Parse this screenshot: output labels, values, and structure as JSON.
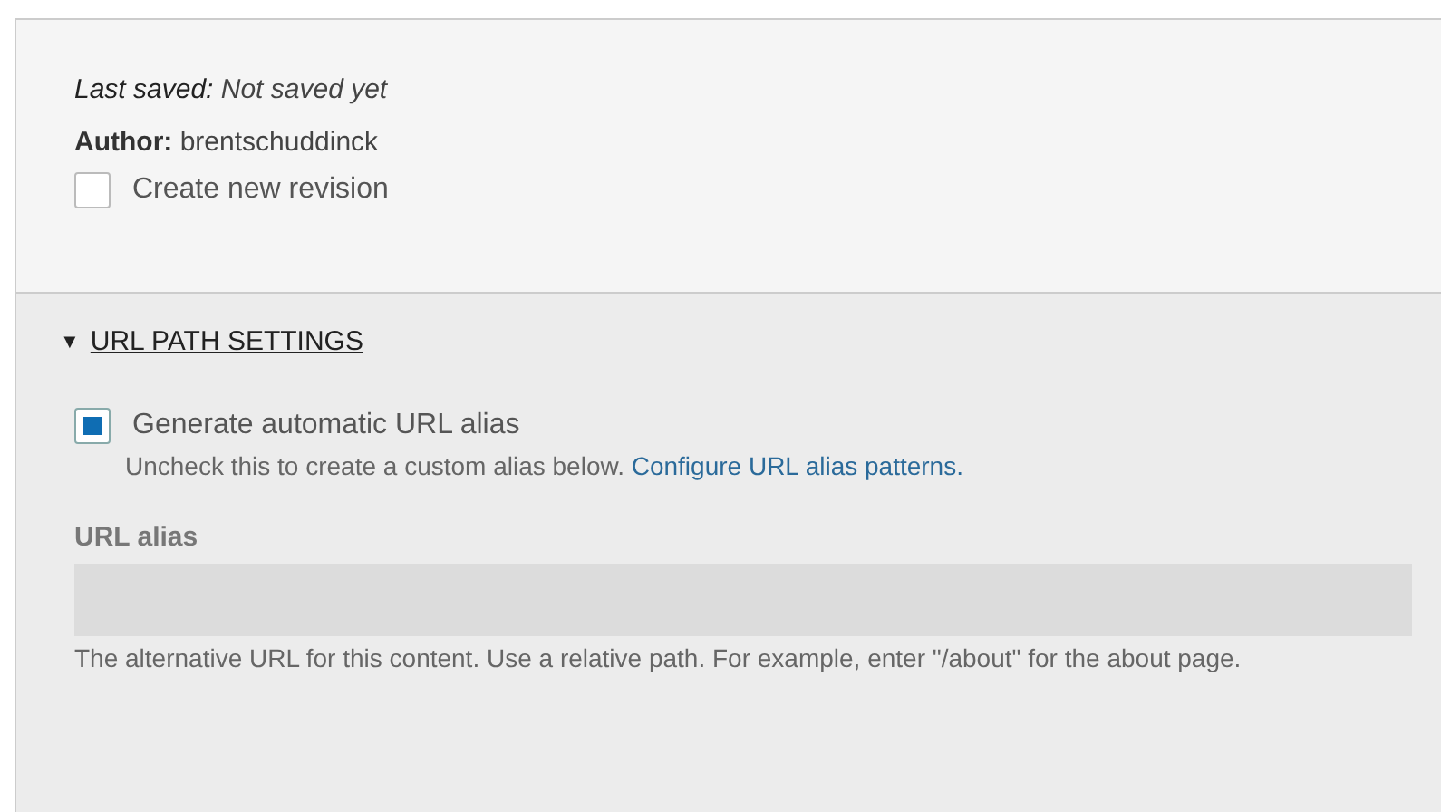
{
  "meta": {
    "last_saved": "**Last saved:** Not saved yet",
    "author": "**Author:** brentschuddinck",
    "revision": {
      "label": "Create new revision",
      "checked": false
    }
  },
  "url_path_settings": {
    "title": "URL PATH SETTINGS",
    "expanded": true,
    "toggle": "▼",
    "auto_alias": {
      "label": "Generate automatic URL alias",
      "checked": true,
      "description": "Uncheck this to create a custom alias below.",
      "link": "Configure URL alias patterns."
    },
    "alias_field": {
      "label": "URL alias",
      "disabled": true,
      "description": "The alternative URL for this content. Use a relative path. For example, enter \"/about\" for the about page."
    }
  }
}
